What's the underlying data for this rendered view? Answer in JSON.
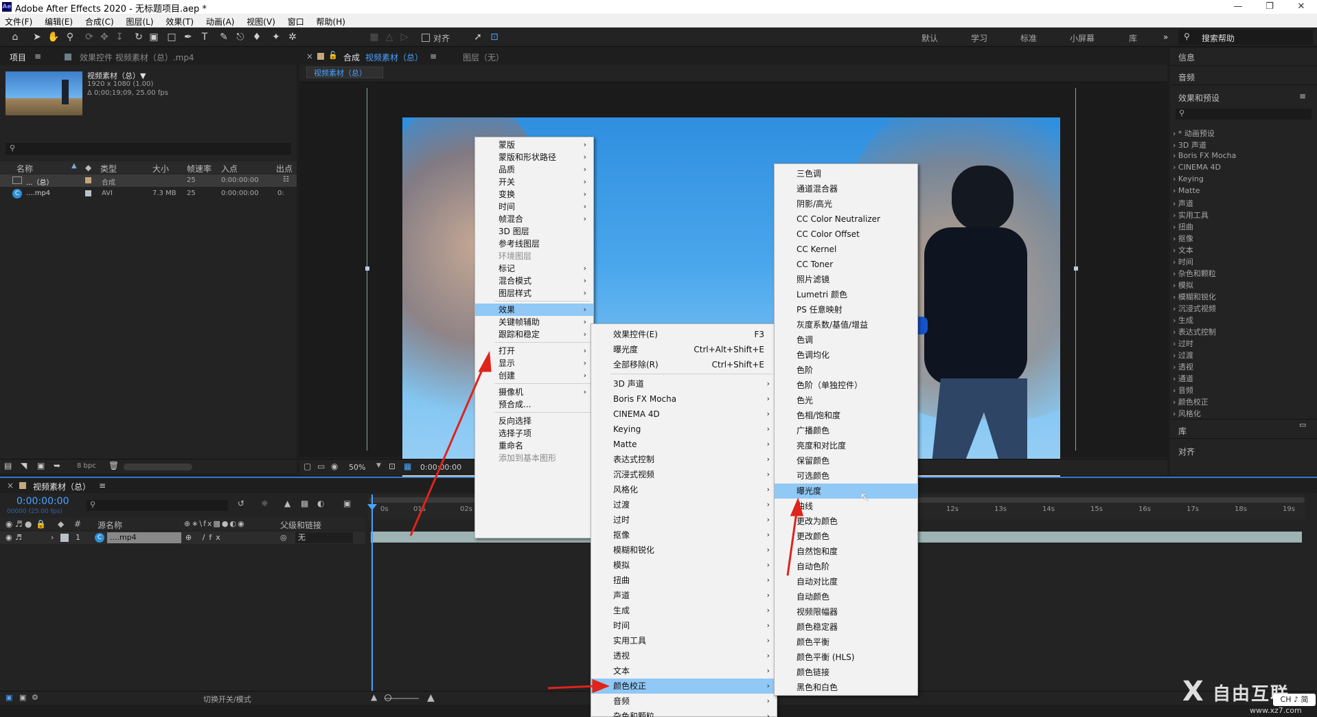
{
  "window": {
    "title": "Adobe After Effects 2020 - 无标题项目.aep *",
    "logo": "Ae",
    "controls": [
      "minimize-icon",
      "restore-icon",
      "close-icon"
    ]
  },
  "menubar": [
    "文件(F)",
    "编辑(E)",
    "合成(C)",
    "图层(L)",
    "效果(T)",
    "动画(A)",
    "视图(V)",
    "窗口",
    "帮助(H)"
  ],
  "toolbar": {
    "align_label": "对齐",
    "workspaces": [
      "默认",
      "学习",
      "标准",
      "小屏幕",
      "库"
    ],
    "search_placeholder": "搜索帮助"
  },
  "project_panel": {
    "tab_project": "项目",
    "tab_effects_controls": "效果控件 视频素材（总）.mp4",
    "asset_name": "视频素材（总）▼",
    "asset_resolution": "1920 x 1080 (1.00)",
    "asset_duration": "Δ 0;00;19;09, 25.00 fps",
    "columns": [
      "名称",
      "类型",
      "大小",
      "帧速率",
      "入点",
      "出点"
    ],
    "rows": [
      {
        "name": "...（总）",
        "type": "合成",
        "size": "",
        "fps": "25",
        "in": "0:00:00:00",
        "out": ""
      },
      {
        "name": "....mp4",
        "type": "AVI",
        "size": "7.3 MB",
        "fps": "25",
        "in": "0:00:00:00",
        "out": "0:"
      }
    ],
    "bpc": "8 bpc"
  },
  "composition_panel": {
    "tab_label": "合成",
    "tab_name": "视频素材（总）",
    "layer_label": "图层（无）",
    "sub_tab": "视频素材（总）",
    "zoom": "50%",
    "timecode": "0:00:00:00"
  },
  "right_panel": {
    "info": "信息",
    "audio": "音频",
    "effects_presets": "效果和预设",
    "effects_list": [
      "* 动画预设",
      "3D 声道",
      "Boris FX Mocha",
      "CINEMA 4D",
      "Keying",
      "Matte",
      "声道",
      "实用工具",
      "扭曲",
      "抠像",
      "文本",
      "时间",
      "杂色和颗粒",
      "模拟",
      "模糊和锐化",
      "沉浸式视频",
      "生成",
      "表达式控制",
      "过时",
      "过渡",
      "透视",
      "通道",
      "音频",
      "颜色校正",
      "风格化"
    ],
    "library": "库",
    "align": "对齐"
  },
  "timeline": {
    "tab_name": "视频素材（总）",
    "timecode": "0:00:00:00",
    "fps_note": "00000 (25.00 fps)",
    "col_source": "源名称",
    "col_parent": "父级和链接",
    "layer_num": "1",
    "layer_name": "....mp4",
    "parent_value": "无",
    "ruler": [
      "0s",
      "01s",
      "02s",
      "12s",
      "13s",
      "14s",
      "15s",
      "16s",
      "17s",
      "18s",
      "19s"
    ],
    "toggle_label": "切换开关/模式"
  },
  "context_menu_1": [
    {
      "label": "蒙版",
      "arrow": true
    },
    {
      "label": "蒙版和形状路径",
      "arrow": true
    },
    {
      "label": "品质",
      "arrow": true
    },
    {
      "label": "开关",
      "arrow": true
    },
    {
      "label": "变换",
      "arrow": true
    },
    {
      "label": "时间",
      "arrow": true
    },
    {
      "label": "帧混合",
      "arrow": true
    },
    {
      "label": "3D 图层",
      "arrow": false
    },
    {
      "label": "参考线图层",
      "arrow": false
    },
    {
      "label": "环境图层",
      "arrow": false,
      "disabled": true
    },
    {
      "label": "标记",
      "arrow": true
    },
    {
      "label": "混合模式",
      "arrow": true
    },
    {
      "label": "图层样式",
      "arrow": true
    },
    {
      "label": "效果",
      "arrow": true,
      "highlighted": true
    },
    {
      "label": "关键帧辅助",
      "arrow": true
    },
    {
      "label": "跟踪和稳定",
      "arrow": true
    },
    {
      "label": "打开",
      "arrow": true
    },
    {
      "label": "显示",
      "arrow": true
    },
    {
      "label": "创建",
      "arrow": true
    },
    {
      "label": "摄像机",
      "arrow": true
    },
    {
      "label": "预合成...",
      "arrow": false
    },
    {
      "label": "反向选择",
      "arrow": false
    },
    {
      "label": "选择子项",
      "arrow": false
    },
    {
      "label": "重命名",
      "arrow": false
    },
    {
      "label": "添加到基本图形",
      "arrow": false,
      "disabled": true
    }
  ],
  "context_menu_2": [
    {
      "label": "效果控件(E)",
      "shortcut": "F3"
    },
    {
      "label": "曝光度",
      "shortcut": "Ctrl+Alt+Shift+E"
    },
    {
      "label": "全部移除(R)",
      "shortcut": "Ctrl+Shift+E"
    },
    {
      "label": "3D 声道",
      "arrow": true
    },
    {
      "label": "Boris FX Mocha",
      "arrow": true
    },
    {
      "label": "CINEMA 4D",
      "arrow": true
    },
    {
      "label": "Keying",
      "arrow": true
    },
    {
      "label": "Matte",
      "arrow": true
    },
    {
      "label": "表达式控制",
      "arrow": true
    },
    {
      "label": "沉浸式视频",
      "arrow": true
    },
    {
      "label": "风格化",
      "arrow": true
    },
    {
      "label": "过渡",
      "arrow": true
    },
    {
      "label": "过时",
      "arrow": true
    },
    {
      "label": "抠像",
      "arrow": true
    },
    {
      "label": "模糊和锐化",
      "arrow": true
    },
    {
      "label": "模拟",
      "arrow": true
    },
    {
      "label": "扭曲",
      "arrow": true
    },
    {
      "label": "声道",
      "arrow": true
    },
    {
      "label": "生成",
      "arrow": true
    },
    {
      "label": "时间",
      "arrow": true
    },
    {
      "label": "实用工具",
      "arrow": true
    },
    {
      "label": "透视",
      "arrow": true
    },
    {
      "label": "文本",
      "arrow": true
    },
    {
      "label": "颜色校正",
      "arrow": true,
      "highlighted": true
    },
    {
      "label": "音频",
      "arrow": true
    },
    {
      "label": "杂色和颗粒",
      "arrow": true
    }
  ],
  "context_menu_3": [
    "三色调",
    "通道混合器",
    "阴影/高光",
    "CC Color Neutralizer",
    "CC Color Offset",
    "CC Kernel",
    "CC Toner",
    "照片滤镜",
    "Lumetri 颜色",
    "PS 任意映射",
    "灰度系数/基值/增益",
    "色调",
    "色调均化",
    "色阶",
    "色阶（单独控件）",
    "色光",
    "色相/饱和度",
    "广播颜色",
    "亮度和对比度",
    "保留颜色",
    "可选颜色",
    "曝光度",
    "曲线",
    "更改为颜色",
    "更改颜色",
    "自然饱和度",
    "自动色阶",
    "自动对比度",
    "自动颜色",
    "视频限幅器",
    "颜色稳定器",
    "颜色平衡",
    "颜色平衡 (HLS)",
    "颜色链接",
    "黑色和白色"
  ],
  "context_menu_3_highlight": "曝光度",
  "watermark": {
    "text": "自由互联",
    "url": "www.xz7.com"
  },
  "ime": "CH ♪ 简"
}
